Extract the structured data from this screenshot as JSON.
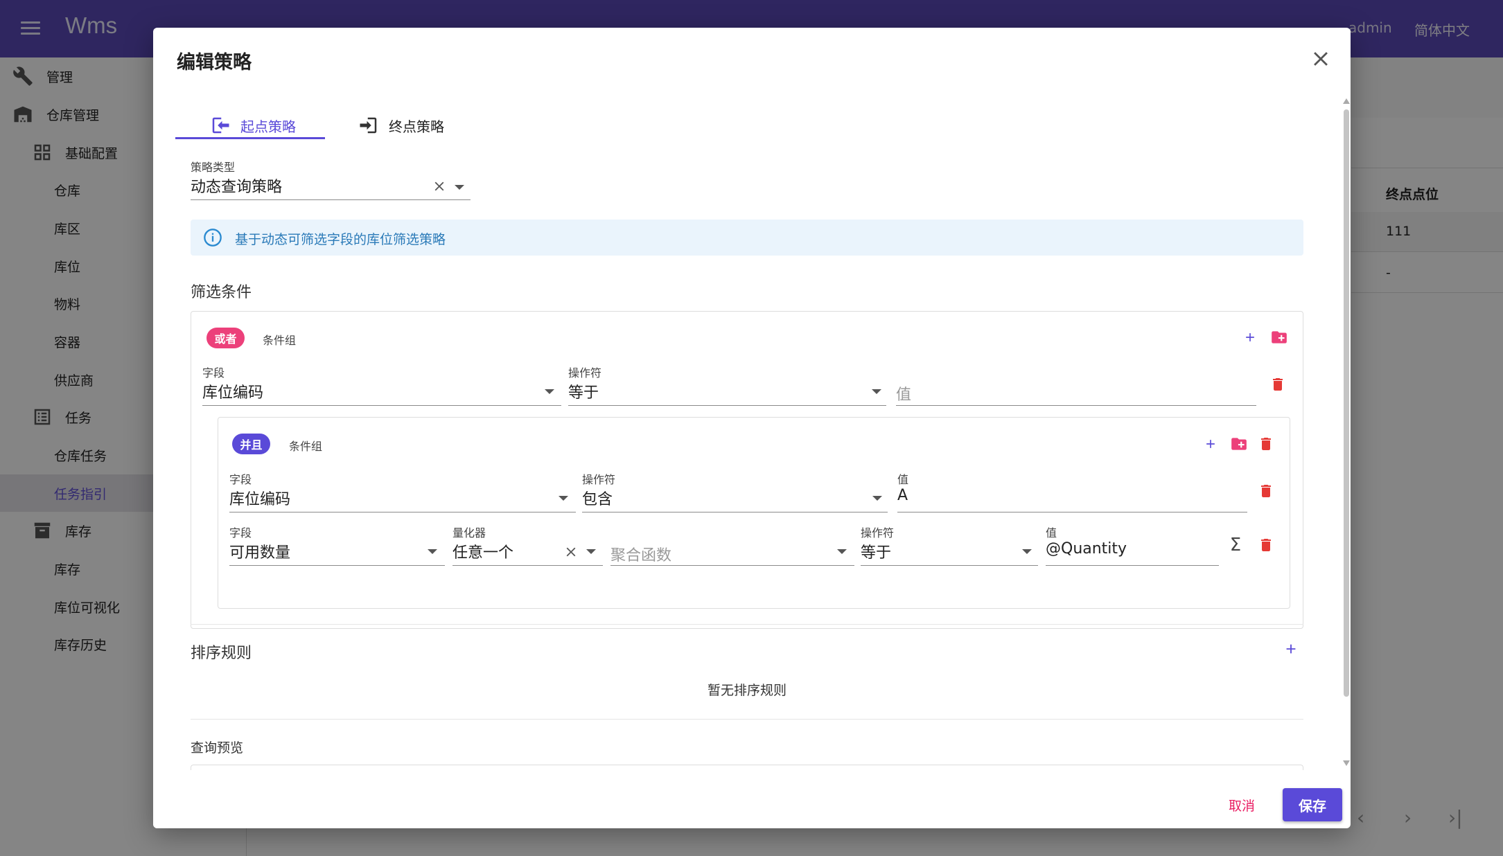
{
  "appbar": {
    "title": "Wms",
    "user": "admin",
    "language": "简体中文"
  },
  "sidebar": {
    "items": [
      {
        "label": "管理",
        "icon": "wrench-icon"
      },
      {
        "label": "仓库管理",
        "icon": "warehouse-icon"
      },
      {
        "label": "基础配置",
        "icon": "grid-icon"
      },
      {
        "label": "仓库"
      },
      {
        "label": "库区"
      },
      {
        "label": "库位"
      },
      {
        "label": "物料"
      },
      {
        "label": "容器"
      },
      {
        "label": "供应商"
      },
      {
        "label": "任务",
        "icon": "list-icon"
      },
      {
        "label": "仓库任务"
      },
      {
        "label": "任务指引",
        "active": true
      },
      {
        "label": "库存",
        "icon": "archive-icon"
      },
      {
        "label": "库存"
      },
      {
        "label": "库位可视化"
      },
      {
        "label": "库存历史"
      }
    ]
  },
  "background_table": {
    "column_header": "终点点位",
    "rows": [
      "111",
      "-"
    ]
  },
  "dialog": {
    "title": "编辑策略",
    "tabs": [
      {
        "label": "起点策略",
        "active": true,
        "icon": "login-icon"
      },
      {
        "label": "终点策略",
        "active": false,
        "icon": "logout-icon"
      }
    ],
    "strategy_type": {
      "label": "策略类型",
      "value": "动态查询策略"
    },
    "info": "基于动态可筛选字段的库位筛选策略",
    "filter_section_title": "筛选条件",
    "root_group": {
      "chip": "或者",
      "chip_color": "#ec407a",
      "note": "条件组",
      "condition": {
        "field_label": "字段",
        "field_value": "库位编码",
        "op_label": "操作符",
        "op_value": "等于",
        "value_placeholder": "值"
      }
    },
    "nested_group": {
      "chip": "并且",
      "chip_color": "#5a4ad8",
      "note": "条件组",
      "condition1": {
        "field_label": "字段",
        "field_value": "库位编码",
        "op_label": "操作符",
        "op_value": "包含",
        "value_label": "值",
        "value": "A"
      },
      "condition2": {
        "field_label": "字段",
        "field_value": "可用数量",
        "quantifier_label": "量化器",
        "quantifier_value": "任意一个",
        "aggregate_placeholder": "聚合函数",
        "op_label": "操作符",
        "op_value": "等于",
        "value_label": "值",
        "value": "@Quantity"
      }
    },
    "sort_section_title": "排序规则",
    "sort_empty": "暂无排序规则",
    "preview_title": "查询预览",
    "cancel": "取消",
    "save": "保存"
  },
  "colors": {
    "primary": "#5a4ad8",
    "danger": "#e53935",
    "pink": "#ec407a"
  }
}
